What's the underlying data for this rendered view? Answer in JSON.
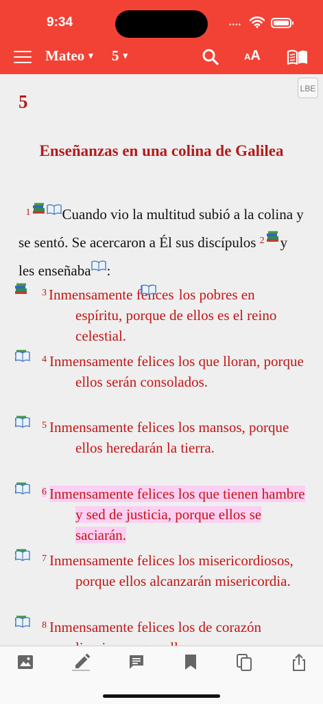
{
  "status": {
    "time": "9:34",
    "signal_dots": "••••"
  },
  "nav": {
    "book": "Mateo",
    "chapter": "5",
    "caret": "▾",
    "font_small": "A",
    "font_big": "A"
  },
  "version": "LBE",
  "chapter_number": "5",
  "section_heading": "Enseñanzas en una colina de Galilea",
  "prose": {
    "v1_num": "1",
    "v1_text": "Cuando vio la multitud subió a la colina y se sentó. Se acercaron a Él sus discípulos ",
    "v2_num": "2",
    "v2_text": "y les enseñaba",
    "v2_end": ":"
  },
  "verses": [
    {
      "num": "3",
      "text": "Inmensamente felices",
      "text2": " los pobres en espíritu, porque de ellos es el reino celestial."
    },
    {
      "num": "4",
      "text": "Inmensamente felices los que lloran, porque ellos serán consolados."
    },
    {
      "num": "5",
      "text": "Inmensamente felices los mansos, porque ellos heredarán la tierra."
    },
    {
      "num": "6",
      "text": "Inmensamente felices los que tienen hambre y sed de justicia, porque ellos se saciarán."
    },
    {
      "num": "7",
      "text": "Inmensamente felices los misericordiosos, porque ellos alcanzarán misericordia."
    },
    {
      "num": "8",
      "text": "Inmensamente felices los de corazón limpio, porque ellos"
    }
  ],
  "colors": {
    "header": "#f24236",
    "accent_red": "#b31b1b",
    "verse_red": "#c41414",
    "highlight": "#fccff4"
  },
  "tabs": [
    "image-icon",
    "pen-icon",
    "notes-icon",
    "bookmark-icon",
    "copy-icon",
    "share-icon"
  ]
}
